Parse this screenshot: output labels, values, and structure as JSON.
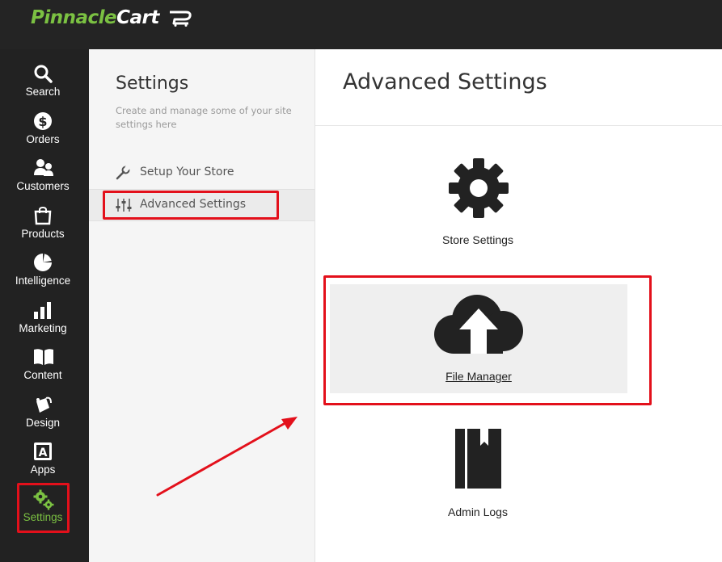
{
  "brand": {
    "logo_part1": "Pinnacle",
    "logo_part2": "Cart",
    "accent_color": "#7bc142"
  },
  "nav": [
    {
      "label": "Search",
      "icon": "search-icon"
    },
    {
      "label": "Orders",
      "icon": "dollar-icon"
    },
    {
      "label": "Customers",
      "icon": "customers-icon"
    },
    {
      "label": "Products",
      "icon": "shopping-bag-icon"
    },
    {
      "label": "Intelligence",
      "icon": "pie-chart-icon"
    },
    {
      "label": "Marketing",
      "icon": "bar-chart-icon"
    },
    {
      "label": "Content",
      "icon": "book-icon"
    },
    {
      "label": "Design",
      "icon": "paint-bucket-icon"
    },
    {
      "label": "Apps",
      "icon": "apps-icon"
    },
    {
      "label": "Settings",
      "icon": "gears-icon",
      "active": true
    }
  ],
  "settings_panel": {
    "title": "Settings",
    "description": "Create and manage some of your site settings here",
    "items": [
      {
        "label": "Setup Your Store",
        "icon": "wrench-icon"
      },
      {
        "label": "Advanced Settings",
        "icon": "sliders-icon",
        "active": true
      }
    ]
  },
  "main": {
    "title": "Advanced Settings",
    "tiles": [
      {
        "label": "Store Settings",
        "icon": "gear-icon"
      },
      {
        "label": "File Manager",
        "icon": "cloud-upload-icon"
      },
      {
        "label": "Admin Logs",
        "icon": "logbook-icon"
      }
    ]
  },
  "highlight_color": "#e3101b"
}
